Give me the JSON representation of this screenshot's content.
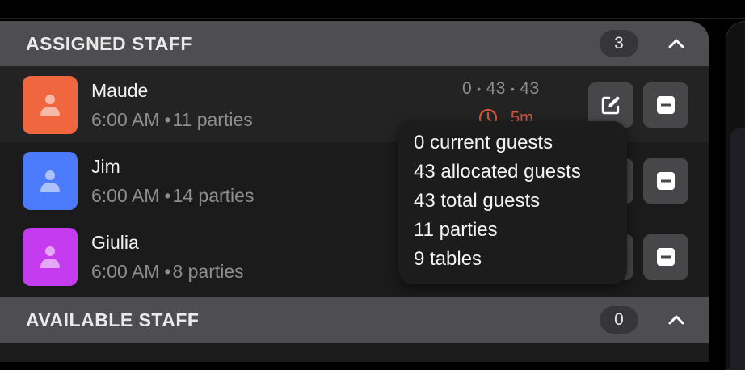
{
  "assigned_section": {
    "title": "ASSIGNED STAFF",
    "count": "3"
  },
  "available_section": {
    "title": "AVAILABLE STAFF",
    "count": "0"
  },
  "staff": [
    {
      "name": "Maude",
      "time": "6:00 AM",
      "parties": "11 parties",
      "avatar_color": "#f0663f",
      "stats": [
        "0",
        "43",
        "43"
      ],
      "timer": "5m"
    },
    {
      "name": "Jim",
      "time": "6:00 AM",
      "parties": "14 parties",
      "avatar_color": "#4b7bfa"
    },
    {
      "name": "Giulia",
      "time": "6:00 AM",
      "parties": "8 parties",
      "avatar_color": "#c53cf0"
    }
  ],
  "tooltip": {
    "current_guests": "0 current guests",
    "allocated_guests": "43 allocated guests",
    "total_guests": "43 total guests",
    "parties": "11 parties",
    "tables": "9 tables"
  },
  "icons": {
    "avatar": "person-icon",
    "edit": "edit-icon",
    "remove": "minus-icon",
    "collapse": "chevron-up-icon",
    "timer": "clock-icon"
  },
  "colors": {
    "timer_accent": "#d8573b",
    "header_bg": "#4e4e50"
  }
}
